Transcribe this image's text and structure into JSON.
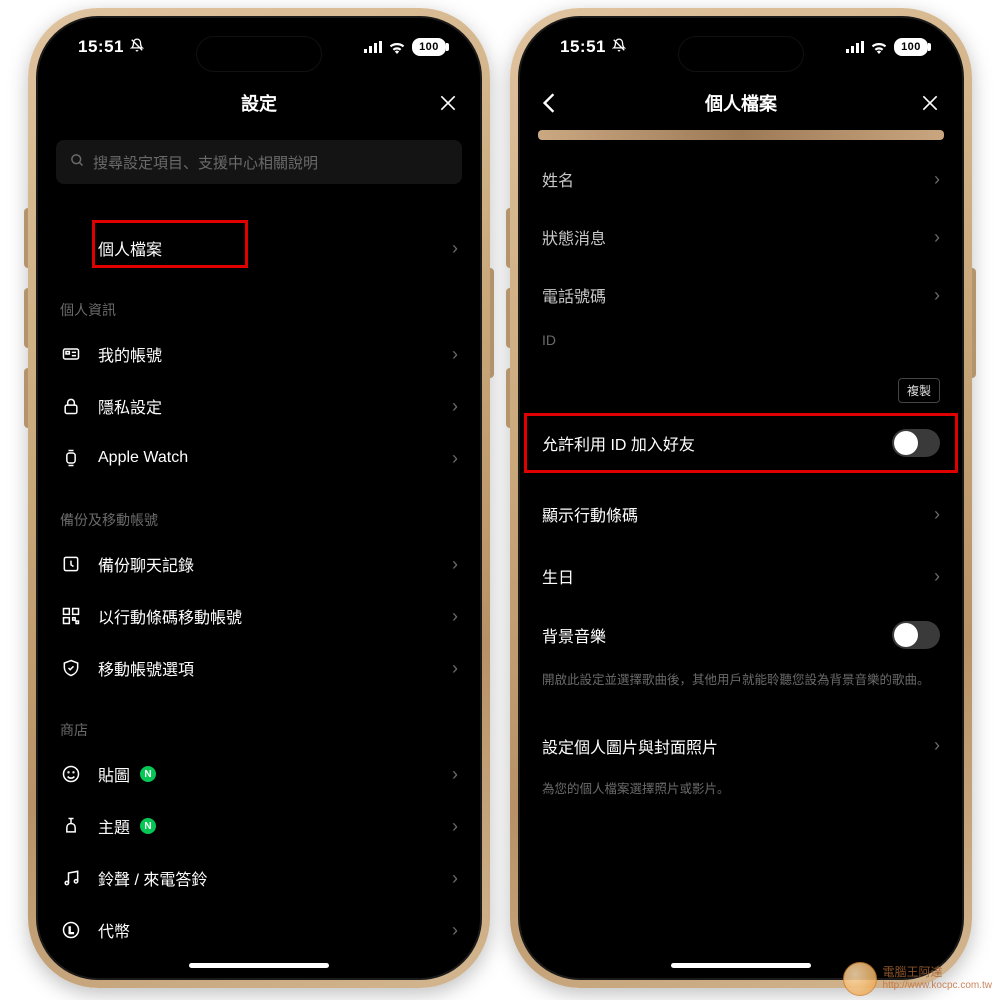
{
  "status": {
    "time": "15:51",
    "battery": "100"
  },
  "left": {
    "title": "設定",
    "search_placeholder": "搜尋設定項目、支援中心相關說明",
    "profile_row": "個人檔案",
    "sections": {
      "personal": {
        "header": "個人資訊",
        "rows": [
          "我的帳號",
          "隱私設定",
          "Apple Watch"
        ]
      },
      "backup": {
        "header": "備份及移動帳號",
        "rows": [
          "備份聊天記錄",
          "以行動條碼移動帳號",
          "移動帳號選項"
        ]
      },
      "shop": {
        "header": "商店",
        "rows": [
          "貼圖",
          "主題",
          "鈴聲 / 來電答鈴",
          "代幣"
        ]
      }
    },
    "badge": "N"
  },
  "right": {
    "title": "個人檔案",
    "rows": {
      "name": "姓名",
      "status_msg": "狀態消息",
      "phone": "電話號碼",
      "id_label": "ID",
      "copy": "複製",
      "allow_id": "允許利用 ID 加入好友",
      "qr": "顯示行動條碼",
      "birthday": "生日",
      "bgm": "背景音樂",
      "bgm_sub": "開啟此設定並選擇歌曲後，其他用戶就能聆聽您設為背景音樂的歌曲。",
      "cover": "設定個人圖片與封面照片",
      "cover_sub": "為您的個人檔案選擇照片或影片。"
    }
  },
  "watermark": {
    "name": "電腦王阿達",
    "url": "http://www.kocpc.com.tw"
  }
}
